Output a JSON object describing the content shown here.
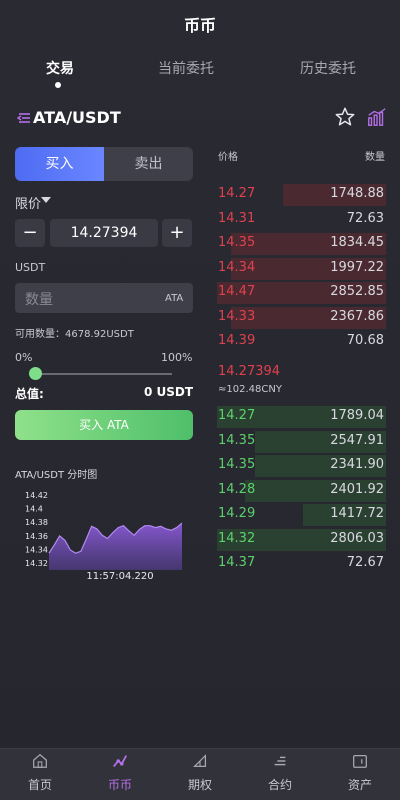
{
  "header": {
    "title": "币币"
  },
  "tabs": [
    {
      "label": "交易"
    },
    {
      "label": "当前委托"
    },
    {
      "label": "历史委托"
    }
  ],
  "pair": {
    "name": "ATA/USDT"
  },
  "trade": {
    "buy_label": "买入",
    "sell_label": "卖出",
    "order_type": "限价",
    "minus": "−",
    "plus": "+",
    "price_value": "14.27394",
    "usdt_label": "USDT",
    "qty_placeholder": "数量",
    "qty_unit": "ATA",
    "available": "可用数量：4678.92USDT",
    "pct_min": "0%",
    "pct_max": "100%",
    "slider_fraction": 0,
    "total_label": "总值:",
    "total_value": "0 USDT",
    "submit_label": "买入 ATA"
  },
  "mini_chart": {
    "title": "ATA/USDT 分时图",
    "time_label": "11:57:04.220"
  },
  "chart_data": {
    "type": "area",
    "title": "ATA/USDT 分时图",
    "yticks": [
      "14.42",
      "14.4",
      "14.38",
      "14.36",
      "14.34",
      "14.32"
    ],
    "ylim": [
      14.32,
      14.42
    ],
    "x": [
      0,
      1,
      2,
      3,
      4,
      5,
      6,
      7,
      8,
      9,
      10,
      11,
      12,
      13,
      14,
      15,
      16,
      17,
      18,
      19,
      20,
      21,
      22,
      23,
      24,
      25
    ],
    "values": [
      14.34,
      14.353,
      14.367,
      14.36,
      14.345,
      14.34,
      14.343,
      14.362,
      14.382,
      14.378,
      14.368,
      14.363,
      14.372,
      14.38,
      14.383,
      14.375,
      14.368,
      14.377,
      14.383,
      14.383,
      14.38,
      14.382,
      14.378,
      14.376,
      14.38,
      14.387
    ],
    "xlabel": "11:57:04.220",
    "line_color": "#9a6ee6"
  },
  "orderbook": {
    "price_header": "价格",
    "qty_header": "数量",
    "asks": [
      {
        "price": "14.27",
        "qty": "1748.88",
        "depth": 0.6
      },
      {
        "price": "14.31",
        "qty": "72.63",
        "depth": 0
      },
      {
        "price": "14.35",
        "qty": "1834.45",
        "depth": 0.9
      },
      {
        "price": "14.34",
        "qty": "1997.22",
        "depth": 0.9
      },
      {
        "price": "14.47",
        "qty": "2852.85",
        "depth": 0.98
      },
      {
        "price": "14.33",
        "qty": "2367.86",
        "depth": 0.9
      },
      {
        "price": "14.39",
        "qty": "70.68",
        "depth": 0
      }
    ],
    "mid_price": "14.27394",
    "mid_cny": "≈102.48CNY",
    "bids": [
      {
        "price": "14.27",
        "qty": "1789.04",
        "depth": 0.98
      },
      {
        "price": "14.35",
        "qty": "2547.91",
        "depth": 0.76
      },
      {
        "price": "14.35",
        "qty": "2341.90",
        "depth": 0.76
      },
      {
        "price": "14.28",
        "qty": "2401.92",
        "depth": 0.82
      },
      {
        "price": "14.29",
        "qty": "1417.72",
        "depth": 0.48
      },
      {
        "price": "14.32",
        "qty": "2806.03",
        "depth": 0.98
      },
      {
        "price": "14.37",
        "qty": "72.67",
        "depth": 0
      }
    ]
  },
  "nav": [
    {
      "label": "首页",
      "icon": "home-icon"
    },
    {
      "label": "币币",
      "icon": "coin-icon",
      "active": true
    },
    {
      "label": "期权",
      "icon": "options-icon"
    },
    {
      "label": "合约",
      "icon": "contract-icon"
    },
    {
      "label": "资产",
      "icon": "wallet-icon"
    }
  ],
  "colors": {
    "accent_purple": "#b56fe6",
    "ask_red": "#e0414d",
    "bid_green": "#5cd16b",
    "buy_blue": "#5a78f6"
  }
}
